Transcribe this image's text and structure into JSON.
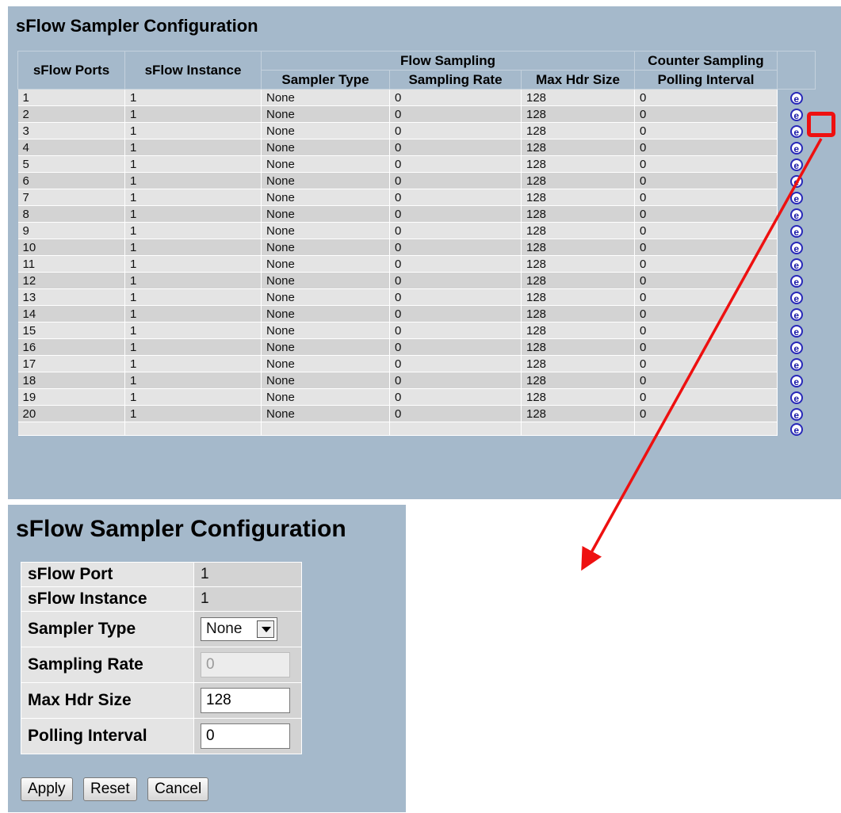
{
  "list": {
    "title": "sFlow Sampler Configuration",
    "headers": {
      "ports": "sFlow Ports",
      "instance": "sFlow Instance",
      "flow_sampling": "Flow Sampling",
      "counter_sampling": "Counter Sampling",
      "sampler_type": "Sampler Type",
      "sampling_rate": "Sampling Rate",
      "max_hdr_size": "Max Hdr Size",
      "polling_interval": "Polling Interval"
    },
    "edit_icon_glyph": "e",
    "rows": [
      {
        "port": "1",
        "instance": "1",
        "sampler_type": "None",
        "sampling_rate": "0",
        "max_hdr_size": "128",
        "polling_interval": "0"
      },
      {
        "port": "2",
        "instance": "1",
        "sampler_type": "None",
        "sampling_rate": "0",
        "max_hdr_size": "128",
        "polling_interval": "0"
      },
      {
        "port": "3",
        "instance": "1",
        "sampler_type": "None",
        "sampling_rate": "0",
        "max_hdr_size": "128",
        "polling_interval": "0"
      },
      {
        "port": "4",
        "instance": "1",
        "sampler_type": "None",
        "sampling_rate": "0",
        "max_hdr_size": "128",
        "polling_interval": "0"
      },
      {
        "port": "5",
        "instance": "1",
        "sampler_type": "None",
        "sampling_rate": "0",
        "max_hdr_size": "128",
        "polling_interval": "0"
      },
      {
        "port": "6",
        "instance": "1",
        "sampler_type": "None",
        "sampling_rate": "0",
        "max_hdr_size": "128",
        "polling_interval": "0"
      },
      {
        "port": "7",
        "instance": "1",
        "sampler_type": "None",
        "sampling_rate": "0",
        "max_hdr_size": "128",
        "polling_interval": "0"
      },
      {
        "port": "8",
        "instance": "1",
        "sampler_type": "None",
        "sampling_rate": "0",
        "max_hdr_size": "128",
        "polling_interval": "0"
      },
      {
        "port": "9",
        "instance": "1",
        "sampler_type": "None",
        "sampling_rate": "0",
        "max_hdr_size": "128",
        "polling_interval": "0"
      },
      {
        "port": "10",
        "instance": "1",
        "sampler_type": "None",
        "sampling_rate": "0",
        "max_hdr_size": "128",
        "polling_interval": "0"
      },
      {
        "port": "11",
        "instance": "1",
        "sampler_type": "None",
        "sampling_rate": "0",
        "max_hdr_size": "128",
        "polling_interval": "0"
      },
      {
        "port": "12",
        "instance": "1",
        "sampler_type": "None",
        "sampling_rate": "0",
        "max_hdr_size": "128",
        "polling_interval": "0"
      },
      {
        "port": "13",
        "instance": "1",
        "sampler_type": "None",
        "sampling_rate": "0",
        "max_hdr_size": "128",
        "polling_interval": "0"
      },
      {
        "port": "14",
        "instance": "1",
        "sampler_type": "None",
        "sampling_rate": "0",
        "max_hdr_size": "128",
        "polling_interval": "0"
      },
      {
        "port": "15",
        "instance": "1",
        "sampler_type": "None",
        "sampling_rate": "0",
        "max_hdr_size": "128",
        "polling_interval": "0"
      },
      {
        "port": "16",
        "instance": "1",
        "sampler_type": "None",
        "sampling_rate": "0",
        "max_hdr_size": "128",
        "polling_interval": "0"
      },
      {
        "port": "17",
        "instance": "1",
        "sampler_type": "None",
        "sampling_rate": "0",
        "max_hdr_size": "128",
        "polling_interval": "0"
      },
      {
        "port": "18",
        "instance": "1",
        "sampler_type": "None",
        "sampling_rate": "0",
        "max_hdr_size": "128",
        "polling_interval": "0"
      },
      {
        "port": "19",
        "instance": "1",
        "sampler_type": "None",
        "sampling_rate": "0",
        "max_hdr_size": "128",
        "polling_interval": "0"
      },
      {
        "port": "20",
        "instance": "1",
        "sampler_type": "None",
        "sampling_rate": "0",
        "max_hdr_size": "128",
        "polling_interval": "0"
      }
    ]
  },
  "callout": {
    "color": "#ee1010"
  },
  "edit_form": {
    "title": "sFlow Sampler Configuration",
    "fields": {
      "port": {
        "label": "sFlow Port",
        "value": "1"
      },
      "instance": {
        "label": "sFlow Instance",
        "value": "1"
      },
      "sampler_type": {
        "label": "Sampler Type",
        "value": "None"
      },
      "sampling_rate": {
        "label": "Sampling Rate",
        "value": "0"
      },
      "max_hdr_size": {
        "label": "Max Hdr Size",
        "value": "128"
      },
      "polling_interval": {
        "label": "Polling Interval",
        "value": "0"
      }
    },
    "buttons": {
      "apply": "Apply",
      "reset": "Reset",
      "cancel": "Cancel"
    }
  }
}
